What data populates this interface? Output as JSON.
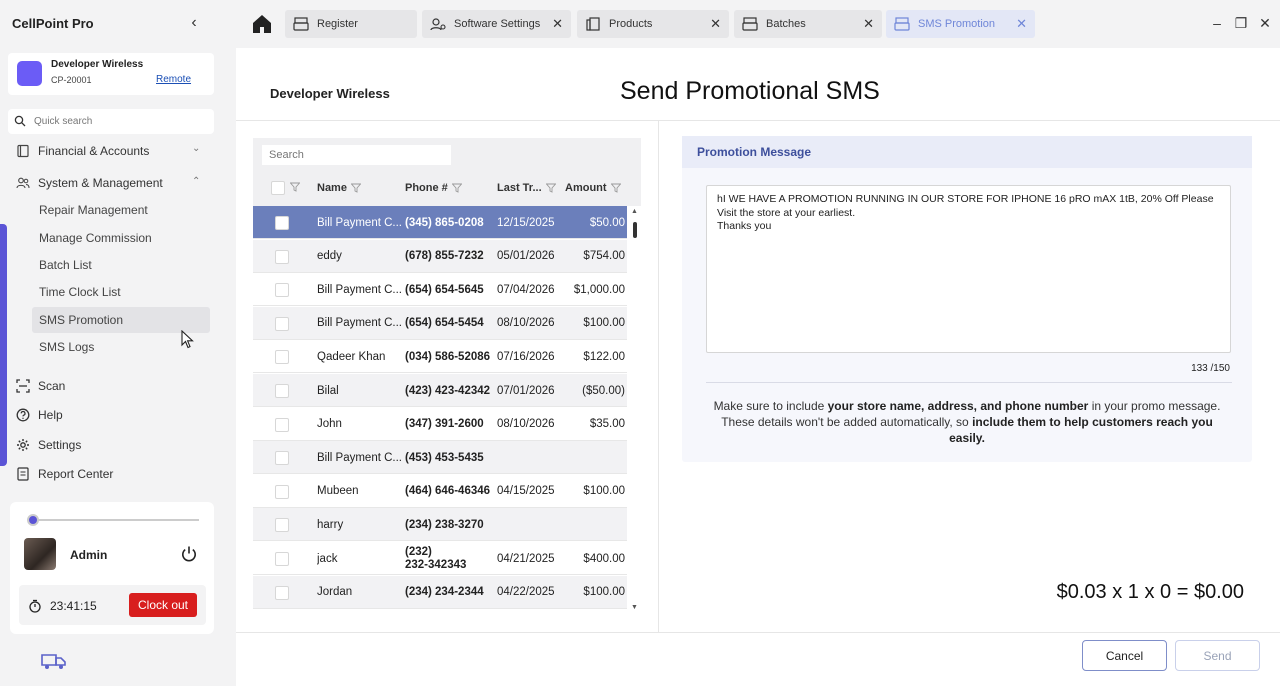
{
  "app": {
    "title": "CellPoint Pro"
  },
  "store": {
    "name": "Developer Wireless",
    "id": "CP-20001",
    "remote_label": "Remote"
  },
  "sidebar": {
    "search_placeholder": "Quick search",
    "groups": [
      {
        "label": "Financial & Accounts",
        "icon": "book-icon"
      },
      {
        "label": "System & Management",
        "icon": "users-icon"
      }
    ],
    "sub_items": [
      "Repair Management",
      "Manage Commission",
      "Batch List",
      "Time Clock List",
      "SMS Promotion",
      "SMS Logs"
    ],
    "bottom_items": [
      {
        "label": "Scan",
        "icon": "scan-icon"
      },
      {
        "label": "Help",
        "icon": "help-icon"
      },
      {
        "label": "Settings",
        "icon": "gear-icon"
      },
      {
        "label": "Report Center",
        "icon": "report-icon"
      }
    ]
  },
  "user": {
    "name": "Admin",
    "clock_time": "23:41:15",
    "clock_out_label": "Clock out"
  },
  "tabs": [
    {
      "label": "Register",
      "icon": "register-icon"
    },
    {
      "label": "Software Settings",
      "icon": "software-settings-icon"
    },
    {
      "label": "Products",
      "icon": "products-icon"
    },
    {
      "label": "Batches",
      "icon": "batches-icon"
    },
    {
      "label": "SMS Promotion",
      "icon": "sms-promotion-icon",
      "active": true
    }
  ],
  "page": {
    "store_name": "Developer Wireless",
    "title": "Send Promotional SMS"
  },
  "grid": {
    "search_placeholder": "Search",
    "columns": [
      "Name",
      "Phone #",
      "Last Tr...",
      "Amount"
    ],
    "rows": [
      {
        "name": "Bill Payment C...",
        "phone": "(345) 865-0208",
        "date": "12/15/2025",
        "amount": "$50.00"
      },
      {
        "name": "eddy",
        "phone": "(678) 855-7232",
        "date": "05/01/2026",
        "amount": "$754.00"
      },
      {
        "name": "Bill Payment C...",
        "phone": "(654) 654-5645",
        "date": "07/04/2026",
        "amount": "$1,000.00"
      },
      {
        "name": "Bill Payment C...",
        "phone": "(654) 654-5454",
        "date": "08/10/2026",
        "amount": "$100.00"
      },
      {
        "name": "Qadeer Khan",
        "phone": "(034) 586-52086",
        "date": "07/16/2026",
        "amount": "$122.00"
      },
      {
        "name": "Bilal",
        "phone": "(423) 423-42342",
        "date": "07/01/2026",
        "amount": "($50.00)"
      },
      {
        "name": "John",
        "phone": "(347) 391-2600",
        "date": "08/10/2026",
        "amount": "$35.00"
      },
      {
        "name": "Bill Payment C...",
        "phone": "(453) 453-5435",
        "date": "",
        "amount": ""
      },
      {
        "name": "Mubeen",
        "phone": "(464) 646-46346",
        "date": "04/15/2025",
        "amount": "$100.00"
      },
      {
        "name": "harry",
        "phone": "(234) 238-3270",
        "date": "",
        "amount": ""
      },
      {
        "name": "jack",
        "phone": "(232)\n232-342343",
        "date": "04/21/2025",
        "amount": "$400.00"
      },
      {
        "name": "Jordan",
        "phone": "(234) 234-2344",
        "date": "04/22/2025",
        "amount": "$100.00"
      }
    ]
  },
  "promo": {
    "heading": "Promotion Message",
    "message": "hI WE HAVE A PROMOTION RUNNING IN OUR STORE FOR IPHONE 16 pRO mAX 1tB, 20% Off Please Visit the store at your earliest.\nThanks you",
    "char_count": "133  /150",
    "note_1": "Make sure to include ",
    "note_2": "your store name, address, and phone number",
    "note_3": " in your promo message.",
    "note_4": "These details won't be added automatically, so ",
    "note_5": "include them to help customers reach you easily."
  },
  "total": "$0.03 x 1 x 0 = $0.00",
  "actions": {
    "cancel": "Cancel",
    "send": "Send"
  },
  "colors": {
    "accent": "#5b54d6",
    "selected_row": "#6b7fbb",
    "clock_out": "#d81e1e",
    "promo_head": "#3d4f9c"
  }
}
